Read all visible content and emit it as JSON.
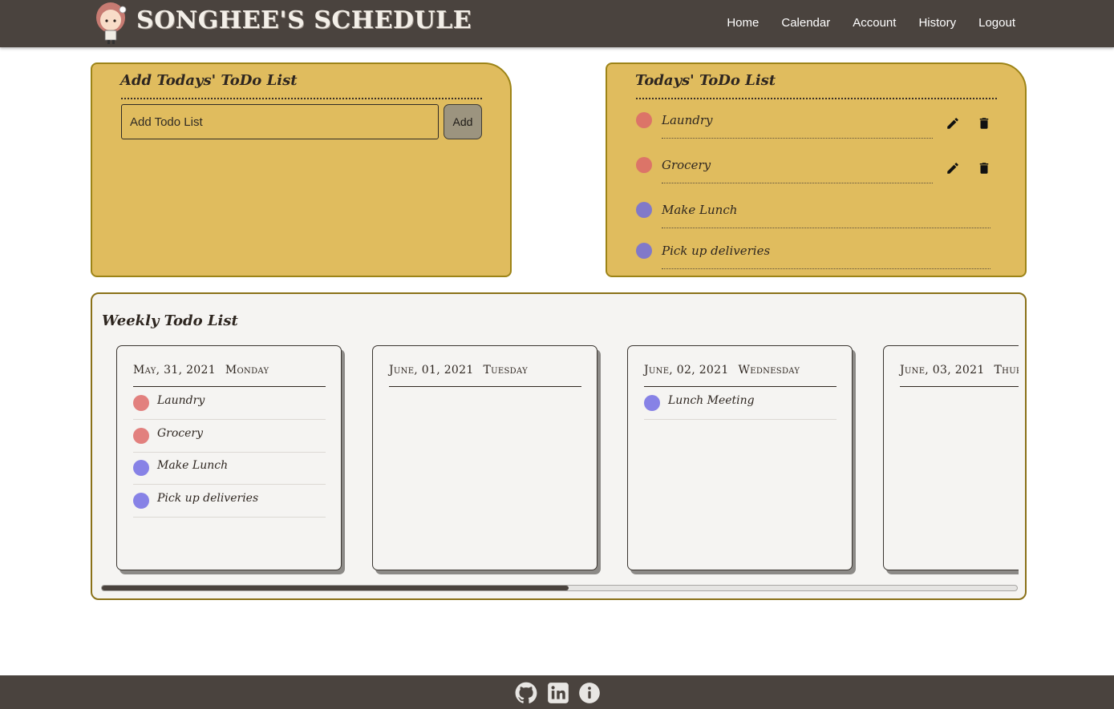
{
  "brand": {
    "title": "SONGHEE'S SCHEDULE"
  },
  "nav": {
    "items": [
      "Home",
      "Calendar",
      "Account",
      "History",
      "Logout"
    ]
  },
  "add_panel": {
    "title": "Add Todays' ToDo List",
    "input_placeholder": "Add Todo List",
    "add_label": "Add"
  },
  "today_panel": {
    "title": "Todays' ToDo List",
    "items": [
      {
        "text": "Laundry",
        "color": "#dc7468",
        "editable": true
      },
      {
        "text": "Grocery",
        "color": "#dc7468",
        "editable": true
      },
      {
        "text": "Make Lunch",
        "color": "#8179c9",
        "editable": false
      },
      {
        "text": "Pick up deliveries",
        "color": "#8179c9",
        "editable": false
      }
    ]
  },
  "weekly": {
    "title": "Weekly Todo List",
    "days": [
      {
        "date": "May, 31, 2021",
        "weekday": "Monday",
        "items": [
          {
            "text": "Laundry",
            "color": "#e2807e"
          },
          {
            "text": "Grocery",
            "color": "#e2807e"
          },
          {
            "text": "Make Lunch",
            "color": "#8782e6"
          },
          {
            "text": "Pick up deliveries",
            "color": "#8782e6"
          }
        ]
      },
      {
        "date": "June, 01, 2021",
        "weekday": "Tuesday",
        "items": []
      },
      {
        "date": "June, 02, 2021",
        "weekday": "Wednesday",
        "items": [
          {
            "text": "Lunch Meeting",
            "color": "#8782e6"
          }
        ]
      },
      {
        "date": "June, 03, 2021",
        "weekday": "Thursday",
        "items": []
      }
    ],
    "scroll_fraction": 0.51
  },
  "footer": {
    "icons": [
      "github-icon",
      "linkedin-icon",
      "info-icon"
    ]
  },
  "colors": {
    "nav_bg": "#4a433e",
    "panel_yellow": "#e0bc5e",
    "panel_border": "#9d8417",
    "weekly_bg": "#f5f4f2"
  }
}
